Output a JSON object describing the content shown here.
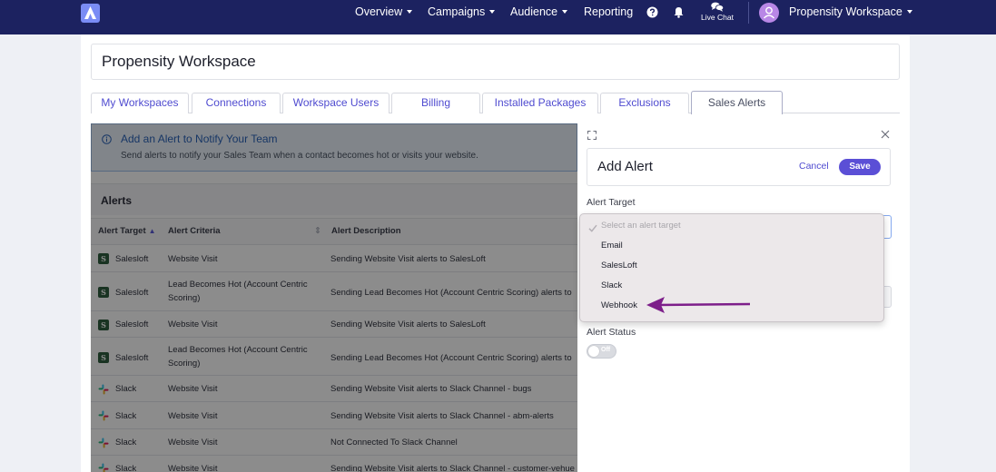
{
  "nav": {
    "items": [
      {
        "label": "Overview",
        "has_caret": true
      },
      {
        "label": "Campaigns",
        "has_caret": true
      },
      {
        "label": "Audience",
        "has_caret": true
      },
      {
        "label": "Reporting",
        "has_caret": false
      }
    ],
    "help_icon": "question-circle-icon",
    "bell_icon": "bell-icon",
    "live_chat_label": "Live Chat",
    "live_chat_icon": "chat-bubbles-icon",
    "workspace_label": "Propensity Workspace",
    "brand_color": "#1c2260"
  },
  "page": {
    "workspace_title": "Propensity Workspace",
    "tabs": [
      {
        "label": "My Workspaces",
        "active": false
      },
      {
        "label": "Connections",
        "active": false
      },
      {
        "label": "Workspace Users",
        "active": false
      },
      {
        "label": "Billing",
        "active": false
      },
      {
        "label": "Installed Packages",
        "active": false
      },
      {
        "label": "Exclusions",
        "active": false
      },
      {
        "label": "Sales Alerts",
        "active": true
      }
    ]
  },
  "info": {
    "title": "Add an Alert to Notify Your Team",
    "subtitle": "Send alerts to notify your Sales Team when a contact becomes hot or visits your website."
  },
  "alerts": {
    "heading": "Alerts",
    "columns": [
      "Alert Target",
      "Alert Criteria",
      "Alert Description"
    ],
    "rows": [
      {
        "target": "Salesloft",
        "icon": "salesloft-icon",
        "criteria": "Website Visit",
        "description": "Sending Website Visit alerts to SalesLoft"
      },
      {
        "target": "Salesloft",
        "icon": "salesloft-icon",
        "criteria": "Lead Becomes Hot (Account Centric Scoring)",
        "description": "Sending Lead Becomes Hot (Account Centric Scoring) alerts to"
      },
      {
        "target": "Salesloft",
        "icon": "salesloft-icon",
        "criteria": "Website Visit",
        "description": "Sending Website Visit alerts to SalesLoft"
      },
      {
        "target": "Salesloft",
        "icon": "salesloft-icon",
        "criteria": "Lead Becomes Hot (Account Centric Scoring)",
        "description": "Sending Lead Becomes Hot (Account Centric Scoring) alerts to"
      },
      {
        "target": "Slack",
        "icon": "slack-icon",
        "criteria": "Website Visit",
        "description": "Sending Website Visit alerts to Slack Channel - bugs"
      },
      {
        "target": "Slack",
        "icon": "slack-icon",
        "criteria": "Website Visit",
        "description": "Sending Website Visit alerts to Slack Channel - abm-alerts"
      },
      {
        "target": "Slack",
        "icon": "slack-icon",
        "criteria": "Website Visit",
        "description": "Not Connected To Slack Channel"
      },
      {
        "target": "Slack",
        "icon": "slack-icon",
        "criteria": "Website Visit",
        "description": "Sending Website Visit alerts to Slack Channel - customer-vehue"
      }
    ]
  },
  "drawer": {
    "title": "Add Alert",
    "cancel_label": "Cancel",
    "save_label": "Save",
    "alert_target_label": "Alert Target",
    "alert_status_label": "Alert Status",
    "toggle_text": "Off",
    "accent_color": "#5b4fd6"
  },
  "dropdown": {
    "placeholder": "Select an alert target",
    "options": [
      "Email",
      "SalesLoft",
      "Slack",
      "Webhook"
    ],
    "annotation_arrow_color": "#7d1e8a"
  }
}
